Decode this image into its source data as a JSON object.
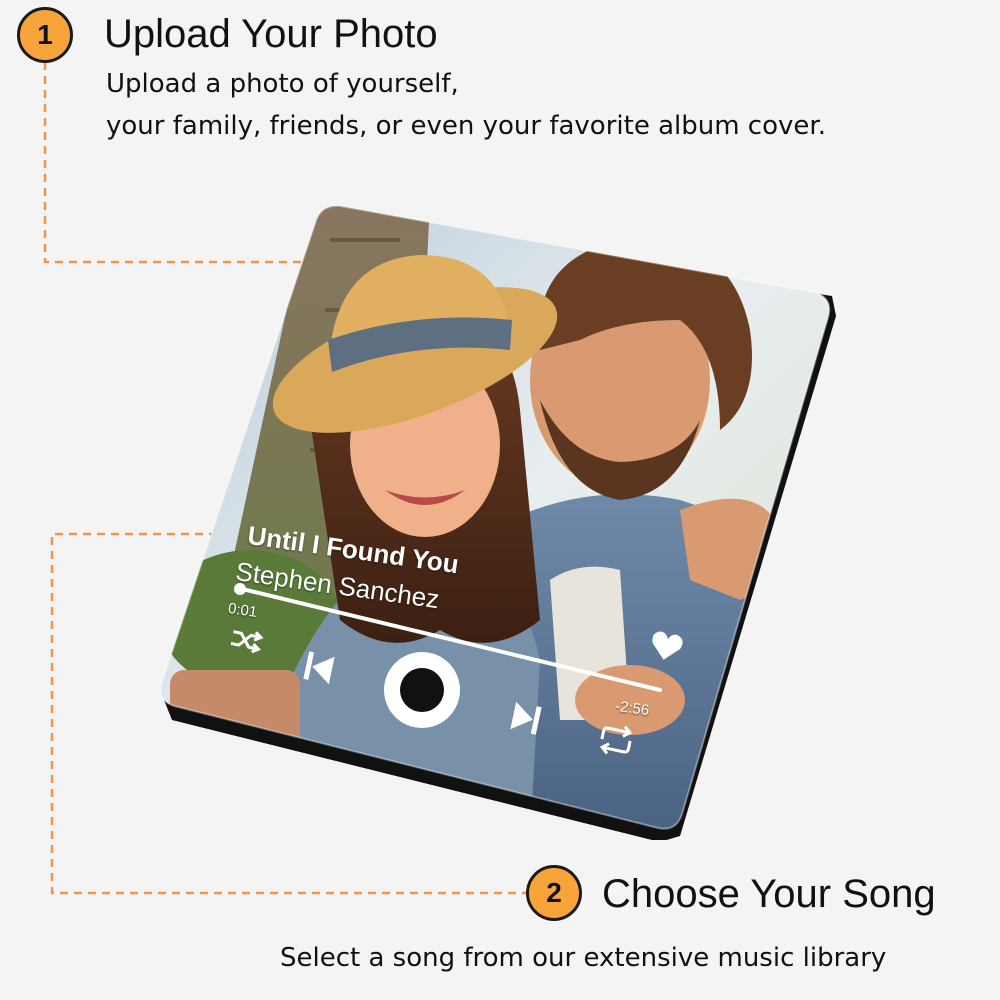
{
  "step1": {
    "number": "1",
    "title": "Upload Your Photo",
    "desc_line1": "Upload a photo of yourself,",
    "desc_line2": "your family, friends, or even your favorite album cover."
  },
  "step2": {
    "number": "2",
    "title": "Choose Your Song",
    "desc": "Select a song from our extensive music library"
  },
  "player": {
    "song_title": "Until I Found You",
    "artist": "Stephen Sanchez",
    "time_elapsed": "0:01",
    "time_remaining": "-2:56",
    "progress": 0.01
  },
  "colors": {
    "accent": "#f7a43a",
    "guide_line": "#f0954a",
    "background": "#f4f4f4"
  },
  "icons": [
    "shuffle-icon",
    "previous-icon",
    "play-icon",
    "next-icon",
    "repeat-icon",
    "heart-icon"
  ]
}
